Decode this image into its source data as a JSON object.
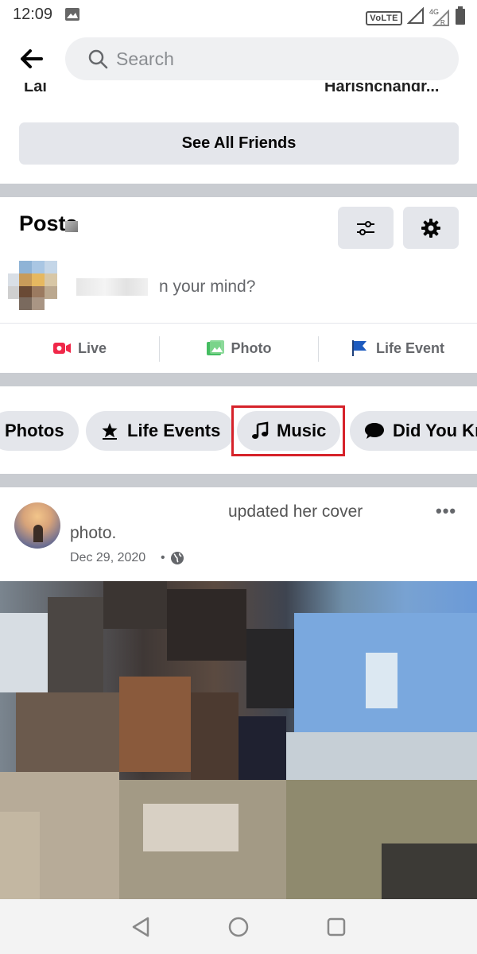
{
  "status_bar": {
    "time": "12:09",
    "volte": "VoLTE",
    "network": "4G",
    "roaming": "R"
  },
  "header": {
    "search_placeholder": "Search"
  },
  "friends": {
    "cut_names": [
      "Lal",
      "Harishchandr..."
    ],
    "see_all_label": "See All Friends"
  },
  "posts": {
    "title": "Posts",
    "composer_prompt": "n your mind?",
    "actions": [
      {
        "label": "Live",
        "icon": "live-video-icon",
        "color": "#f02849"
      },
      {
        "label": "Photo",
        "icon": "photo-icon",
        "color": "#45bd62"
      },
      {
        "label": "Life Event",
        "icon": "flag-icon",
        "color": "#1877f2"
      }
    ]
  },
  "chips": [
    {
      "label": "Photos",
      "icon": ""
    },
    {
      "label": "Life Events",
      "icon": "star-icon"
    },
    {
      "label": "Music",
      "icon": "music-note-icon"
    },
    {
      "label": "Did You Kn",
      "icon": "speech-bubble-icon"
    }
  ],
  "post": {
    "headline": "updated her cover",
    "headline_cont": "photo.",
    "date": "Dec 29, 2020",
    "separator": "•",
    "more": "•••"
  },
  "colors": {
    "highlight": "#d6222a",
    "divider": "#c9ccd1",
    "button_bg": "#e4e6eb"
  }
}
